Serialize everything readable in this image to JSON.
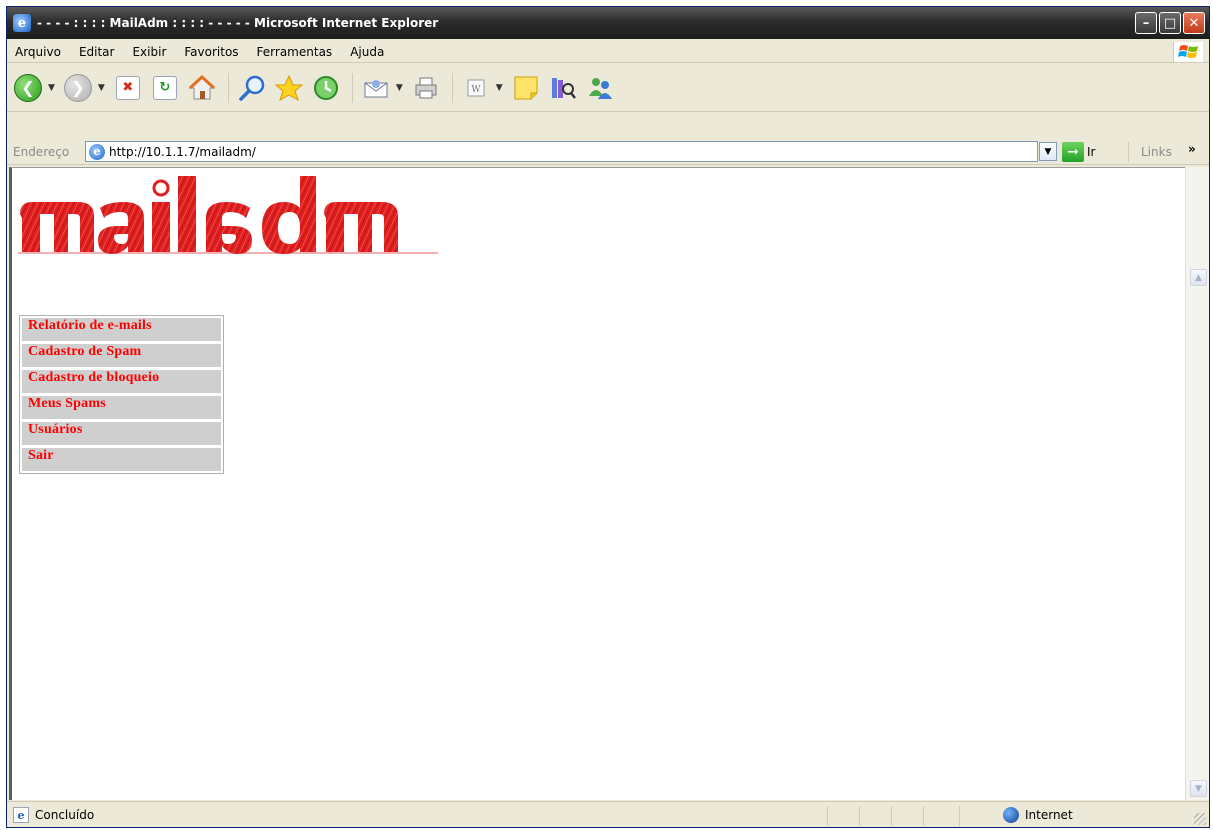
{
  "window": {
    "title": "- - - - : : : : MailAdm : : : : - - - - - Microsoft Internet Explorer",
    "buttons": [
      "minimize",
      "maximize",
      "close"
    ]
  },
  "menubar": {
    "items": [
      "Arquivo",
      "Editar",
      "Exibir",
      "Favoritos",
      "Ferramentas",
      "Ajuda"
    ]
  },
  "toolbar": {
    "icons": [
      "back-icon",
      "forward-icon",
      "stop-icon",
      "refresh-icon",
      "home-icon",
      "search-icon",
      "favorites-icon",
      "history-icon",
      "mail-icon",
      "print-icon",
      "edit-icon",
      "notes-icon",
      "research-icon",
      "messenger-icon"
    ]
  },
  "addressbar": {
    "label": "Endereço",
    "url": "http://10.1.1.7/mailadm/",
    "go_label": "Ir",
    "links_label": "Links",
    "more": "»"
  },
  "page": {
    "logo_text": "mailadm",
    "menu": [
      "Relatório de e-mails",
      "Cadastro de Spam",
      "Cadastro de bloqueio",
      "Meus Spams",
      "Usuários",
      "Sair"
    ]
  },
  "statusbar": {
    "text": "Concluído",
    "zone": "Internet"
  },
  "colors": {
    "menu_text": "#ff0000",
    "menu_bg": "#cfcfcf",
    "logo": "#e02020"
  }
}
